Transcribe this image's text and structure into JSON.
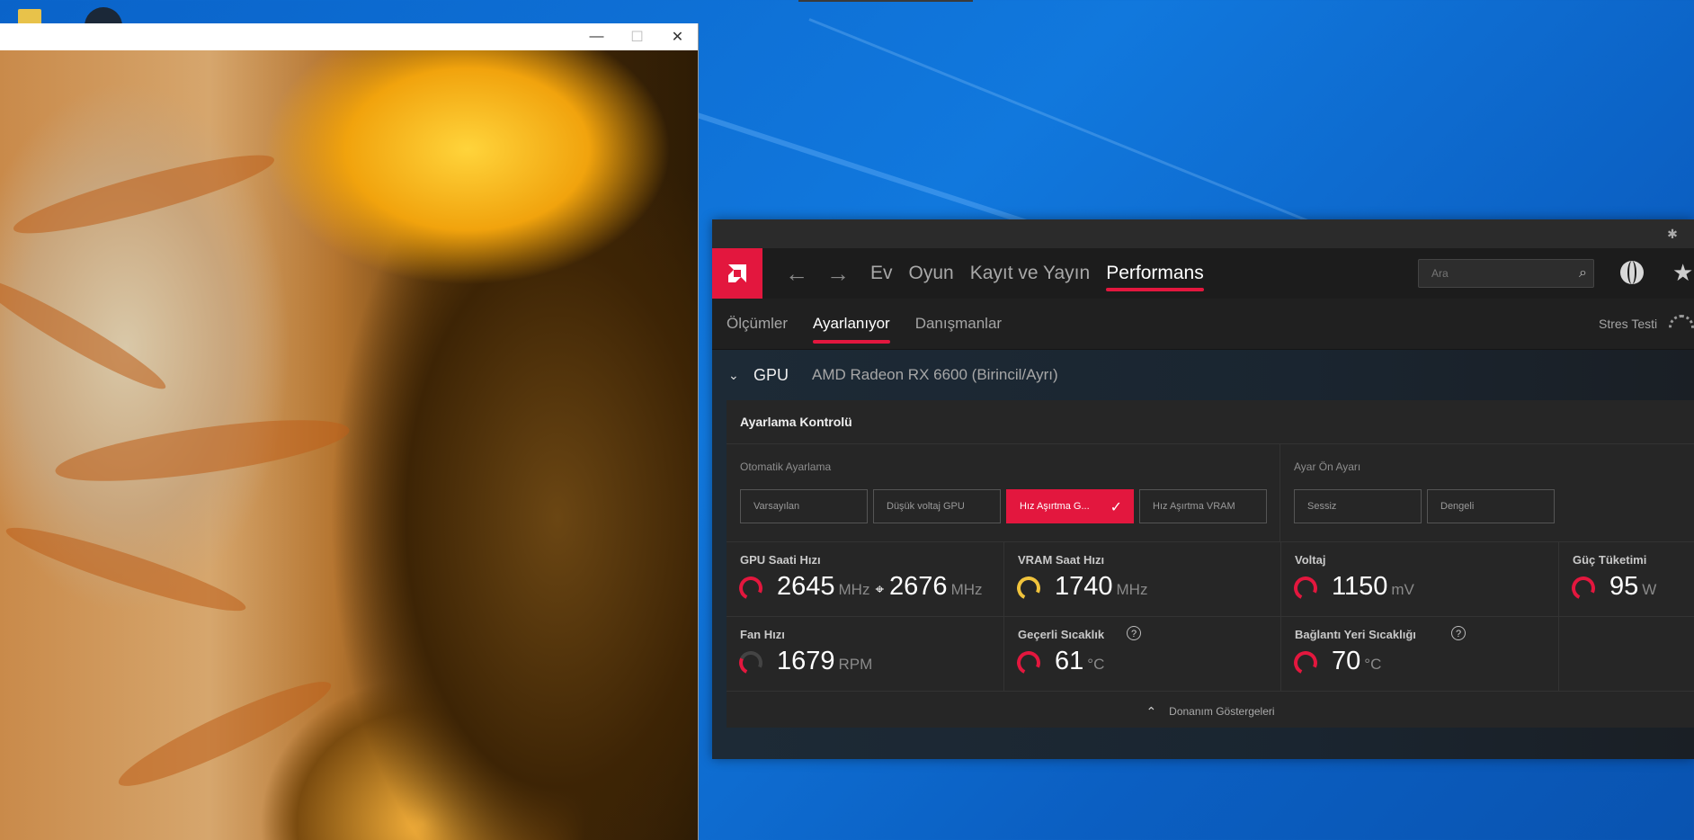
{
  "amd": {
    "nav": {
      "items": [
        "Ev",
        "Oyun",
        "Kayıt ve Yayın",
        "Performans"
      ]
    },
    "search": {
      "placeholder": "Ara"
    },
    "subnav": {
      "items": [
        "Ölçümler",
        "Ayarlanıyor",
        "Danışmanlar"
      ],
      "stress": "Stres Testi"
    },
    "gpu": {
      "label": "GPU",
      "name": "AMD Radeon RX 6600 (Birincil/Ayrı)"
    },
    "panel": {
      "title": "Ayarlama Kontrolü",
      "auto": {
        "title": "Otomatik Ayarlama",
        "buttons": [
          "Varsayılan",
          "Düşük voltaj GPU",
          "Hız Aşırtma G...",
          "Hız Aşırtma VRAM"
        ]
      },
      "preset": {
        "title": "Ayar Ön Ayarı",
        "buttons": [
          "Sessiz",
          "Dengeli"
        ]
      },
      "metrics": {
        "gpu_clock": {
          "label": "GPU Saati Hızı",
          "value1": "2645",
          "unit1": "MHz",
          "value2": "2676",
          "unit2": "MHz"
        },
        "vram_clock": {
          "label": "VRAM Saat Hızı",
          "value": "1740",
          "unit": "MHz"
        },
        "voltage": {
          "label": "Voltaj",
          "value": "1150",
          "unit": "mV"
        },
        "power": {
          "label": "Güç Tüketimi",
          "value": "95",
          "unit": "W"
        },
        "fan": {
          "label": "Fan Hızı",
          "value": "1679",
          "unit": "RPM"
        },
        "temp": {
          "label": "Geçerli Sıcaklık",
          "value": "61",
          "unit": "°C"
        },
        "junction": {
          "label": "Bağlantı Yeri Sıcaklığı",
          "value": "70",
          "unit": "°C"
        }
      },
      "footer": "Donanım Göstergeleri"
    },
    "colors": {
      "accent": "#e3173e",
      "panel": "#262626"
    }
  }
}
